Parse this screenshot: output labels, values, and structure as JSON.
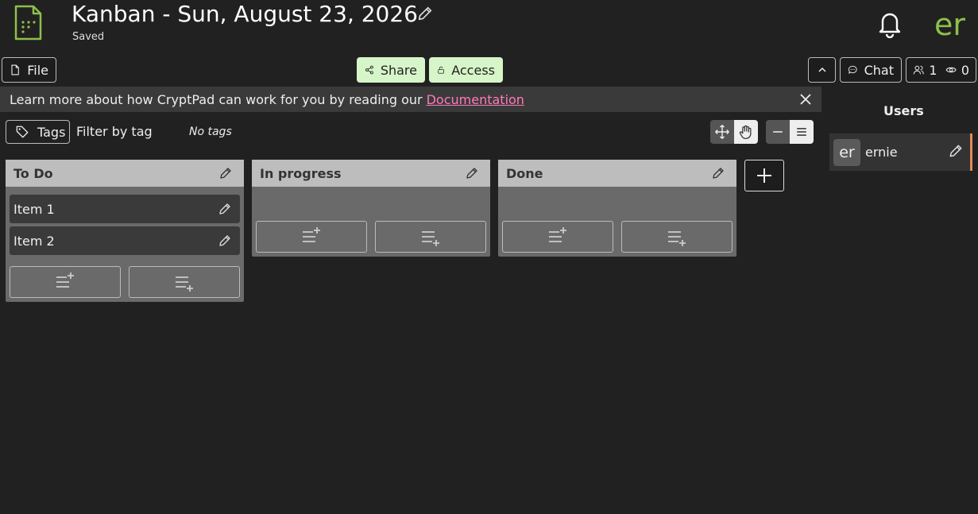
{
  "header": {
    "title": "Kanban - Sun, August 23, 2026",
    "status": "Saved",
    "user_initials": "er",
    "icons": {
      "app": "kanban-file-icon",
      "edit": "pencil-icon",
      "notifications": "bell-icon"
    },
    "accent_color": "#8dc04a"
  },
  "toolbar": {
    "file_label": "File",
    "share_label": "Share",
    "access_label": "Access",
    "chat_label": "Chat",
    "users_count": "1",
    "viewers_count": "0"
  },
  "infobar": {
    "text": "Learn more about how CryptPad can work for you by reading our",
    "link": "Documentation",
    "link_color": "#ff7ab8"
  },
  "users_panel": {
    "title": "Users",
    "users": [
      {
        "initials": "er",
        "name": "ernie"
      }
    ]
  },
  "tags": {
    "button_label": "Tags",
    "filter_label": "Filter by tag",
    "empty_text": "No tags"
  },
  "boards": [
    {
      "title": "To Do",
      "items": [
        "Item 1",
        "Item 2"
      ]
    },
    {
      "title": "In progress",
      "items": []
    },
    {
      "title": "Done",
      "items": []
    }
  ]
}
